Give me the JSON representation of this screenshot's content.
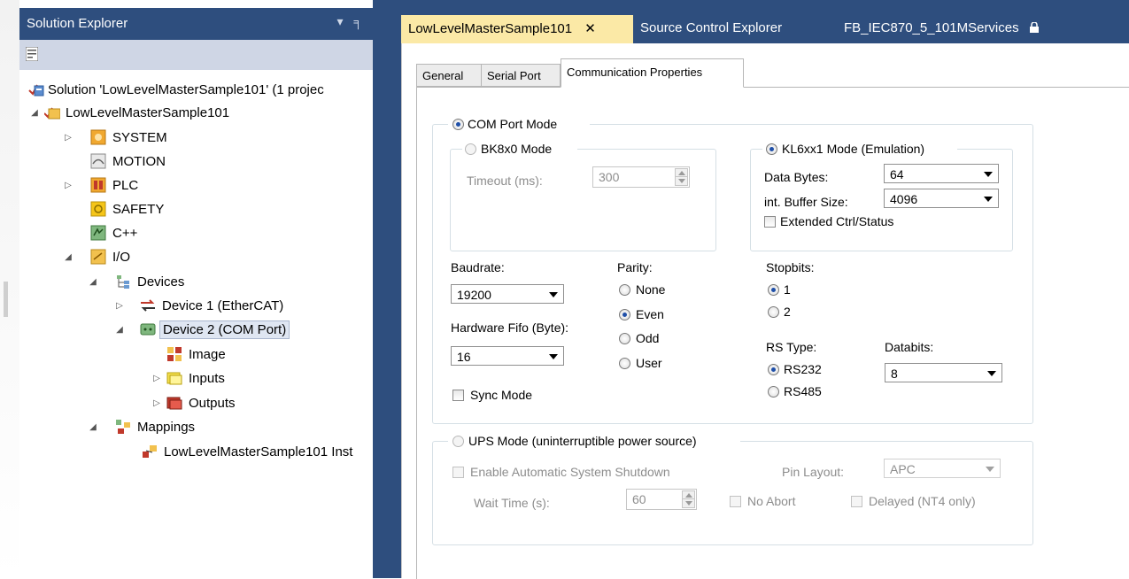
{
  "solution_explorer": {
    "title": "Solution Explorer",
    "controls": "▾ ╕ ✕",
    "tree": [
      {
        "label": "Solution 'LowLevelMasterSample101' (1 projec",
        "icon": "solution-icon"
      },
      {
        "label": "LowLevelMasterSample101",
        "icon": "project-icon"
      },
      {
        "label": "SYSTEM",
        "icon": "system-icon"
      },
      {
        "label": "MOTION",
        "icon": "motion-icon"
      },
      {
        "label": "PLC",
        "icon": "plc-icon"
      },
      {
        "label": "SAFETY",
        "icon": "safety-icon"
      },
      {
        "label": "C++",
        "icon": "cpp-icon"
      },
      {
        "label": "I/O",
        "icon": "io-icon"
      },
      {
        "label": "Devices",
        "icon": "devices-icon"
      },
      {
        "label": "Device 1 (EtherCAT)",
        "icon": "ethercat-device-icon"
      },
      {
        "label": "Device 2 (COM Port)",
        "icon": "com-port-device-icon"
      },
      {
        "label": "Image",
        "icon": "image-icon"
      },
      {
        "label": "Inputs",
        "icon": "inputs-icon"
      },
      {
        "label": "Outputs",
        "icon": "outputs-icon"
      },
      {
        "label": "Mappings",
        "icon": "mappings-icon"
      },
      {
        "label": "LowLevelMasterSample101 Inst",
        "icon": "mapping-instance-icon"
      }
    ]
  },
  "doc_tabs": [
    {
      "label": "LowLevelMasterSample101",
      "close": "✕",
      "active": true
    },
    {
      "label": "Source Control Explorer",
      "active": false
    },
    {
      "label": "FB_IEC870_5_101MServices",
      "active": false
    }
  ],
  "property_tabs": [
    "General",
    "Serial Port",
    "Communication Properties"
  ],
  "com_port": {
    "title": "COM Port Mode",
    "bk": {
      "title": "BK8x0 Mode",
      "timeout_label": "Timeout (ms):",
      "timeout_value": "300"
    },
    "kl": {
      "title": "KL6xx1 Mode (Emulation)",
      "data_bytes_label": "Data Bytes:",
      "data_bytes_value": "64",
      "buffer_label": "int. Buffer Size:",
      "buffer_value": "4096",
      "extended_label": "Extended Ctrl/Status"
    },
    "baudrate_label": "Baudrate:",
    "baudrate_value": "19200",
    "fifo_label": "Hardware Fifo (Byte):",
    "fifo_value": "16",
    "sync_label": "Sync Mode",
    "parity_label": "Parity:",
    "parity_options": [
      "None",
      "Even",
      "Odd",
      "User"
    ],
    "parity_selected": "Even",
    "stopbits_label": "Stopbits:",
    "stopbits_options": [
      "1",
      "2"
    ],
    "stopbits_selected": "1",
    "rstype_label": "RS Type:",
    "rstype_options": [
      "RS232",
      "RS485"
    ],
    "rstype_selected": "RS232",
    "databits_label": "Databits:",
    "databits_value": "8"
  },
  "ups": {
    "title": "UPS Mode (uninterruptible power source)",
    "enable_label": "Enable Automatic System Shutdown",
    "pin_layout_label": "Pin Layout:",
    "pin_layout_value": "APC",
    "wait_label": "Wait Time (s):",
    "wait_value": "60",
    "no_abort_label": "No Abort",
    "delayed_label": "Delayed (NT4 only)"
  },
  "colors": {
    "title_bar": "#2e4e7e",
    "active_tab": "#fbe9a6",
    "toolbar": "#cfd6e5"
  }
}
